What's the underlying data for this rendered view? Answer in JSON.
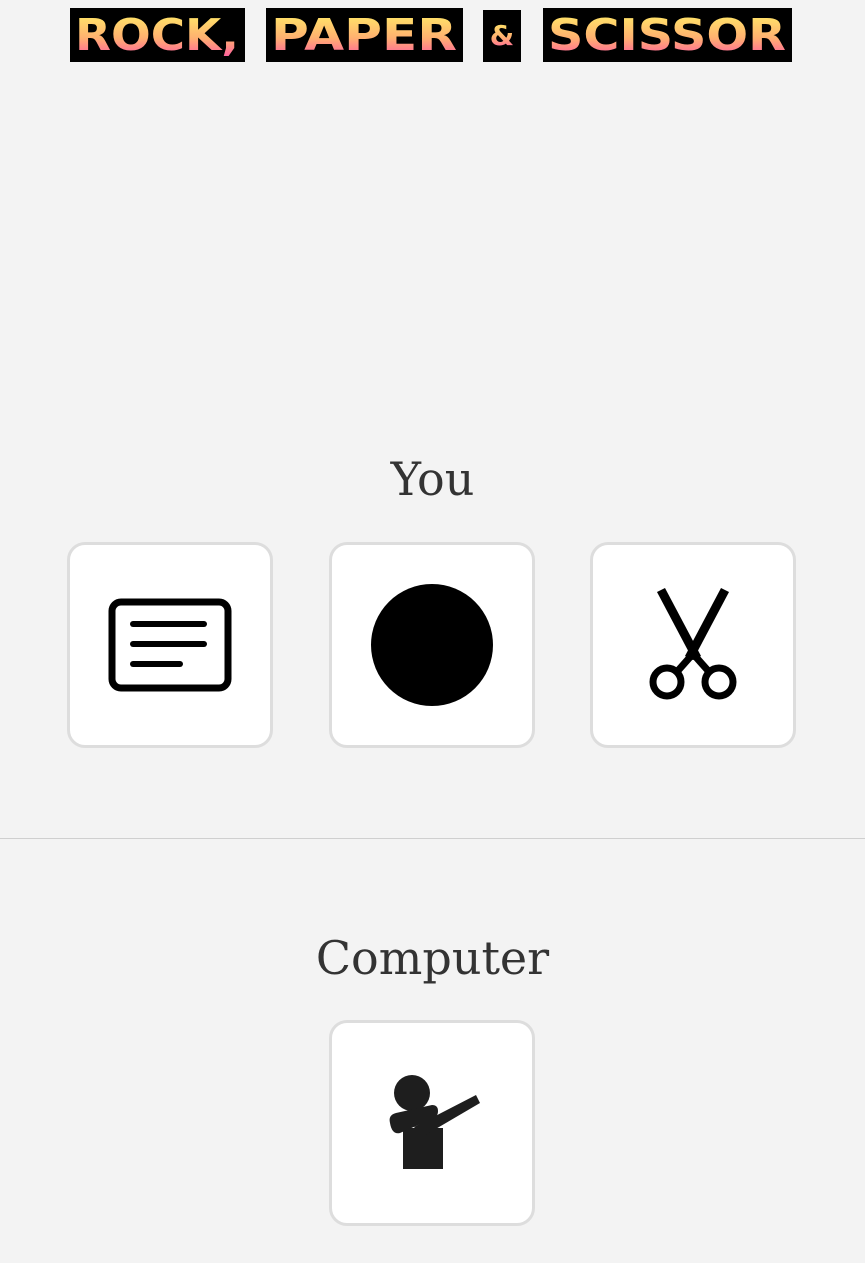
{
  "header": {
    "title_part1": "ROCK,",
    "title_part2": "PAPER",
    "title_amp": "&",
    "title_part3": "SCISSOR",
    "gradient_top": "#fff066",
    "gradient_bottom": "#ff4fa8"
  },
  "player": {
    "label": "You",
    "choices": [
      {
        "name": "paper",
        "icon": "paper-icon"
      },
      {
        "name": "rock",
        "icon": "rock-icon"
      },
      {
        "name": "scissors",
        "icon": "scissors-icon"
      }
    ]
  },
  "computer": {
    "label": "Computer",
    "choice_icon": "dab-person-icon"
  },
  "colors": {
    "background": "#f3f3f3",
    "card_background": "#ffffff",
    "card_border": "#dddddd",
    "label_text": "#333333",
    "icon": "#000000",
    "computer_icon": "#1e1e1e"
  }
}
